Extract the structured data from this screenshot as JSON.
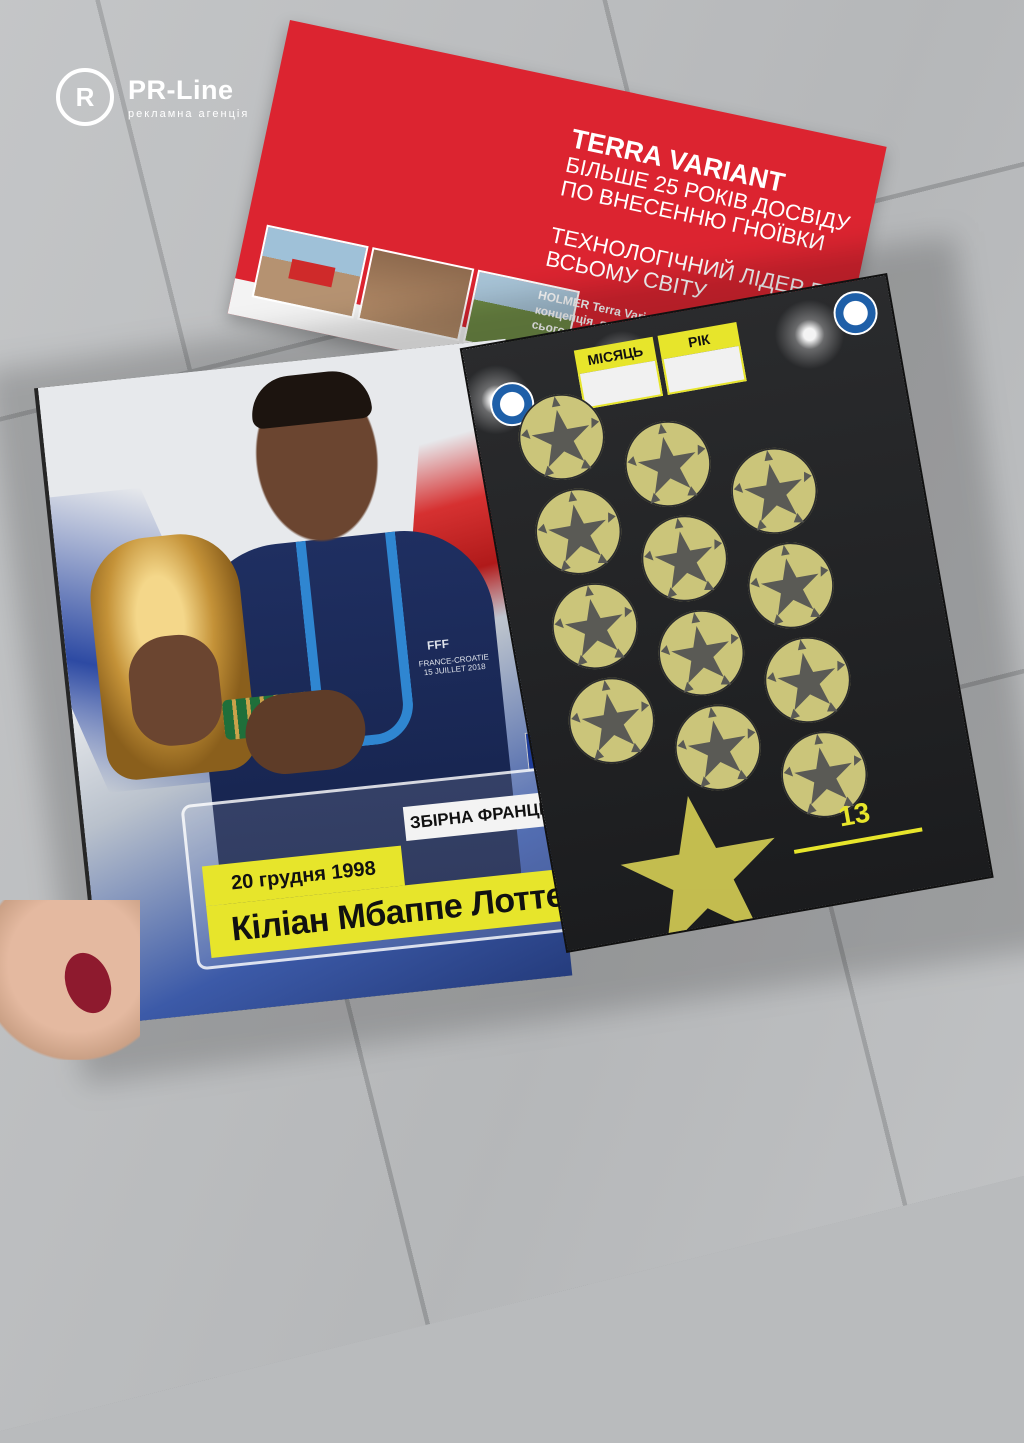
{
  "watermark": {
    "brand": "PR-Line",
    "tagline": "рекламна агенція",
    "mark": "R"
  },
  "brochure": {
    "title": "TERRA VARIANT",
    "line1": "БІЛЬШЕ 25 РОКІВ ДОСВІДУ ПО ВНЕСЕННЮ  ГНОЇВКИ",
    "line2": "ТЕХНОЛОГІЧНИЙ ЛІДЕР ПО ВСЬОМУ СВІТУ",
    "body": "HOLMER Terra Variant - це економічна концепція, яку Ви можете вик... сьогодні"
  },
  "left_page": {
    "jersey_badge": "FFF",
    "jersey_match": "FRANCE-CROATIE 15 JUILLET 2018",
    "country_label": "ЗБІРНА ФРАНЦІЇ",
    "birth_date": "20 грудня 1998",
    "player_name": "Кіліан Мбаппе Лоттен",
    "flag_colors": [
      "#1f3d9a",
      "#ffffff",
      "#d8262f"
    ]
  },
  "right_page": {
    "month_label": "МІСЯЦЬ",
    "year_label": "РІК",
    "page_number": "13",
    "sticker_count": 12,
    "accent": "#e7e52b"
  }
}
